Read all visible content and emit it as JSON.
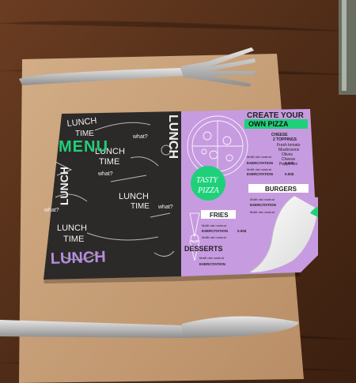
{
  "left_panel": {
    "menu": "MENU",
    "lunch_big": "LUNCH",
    "lunch_time": [
      "LUNCH",
      "TIME"
    ],
    "lunch_time_2": [
      "LUNCH",
      "TIME"
    ],
    "lunch_time_3": [
      "LUNCH",
      "TIME"
    ],
    "lunch_vertical": "LUNCH",
    "whats": [
      "what?",
      "what?",
      "what?",
      "what?"
    ]
  },
  "right_panel": {
    "create_your": "CREATE YOUR",
    "own_pizza": "OWN PIZZA",
    "toppings_title": "CHEESE\n2 TOPPINGS",
    "toppings": [
      "Fresh tomato",
      "Mushrooms",
      "Olives",
      "Cheese",
      "Pepperoni"
    ],
    "tasty": "TASTY",
    "pizza": "PIZZA",
    "burgers": "BURGERS",
    "fries": "FRIES",
    "desserts": "DESSERTS",
    "item_text": "Mollit nisi nostrud",
    "exercitation": "EXERCITATION",
    "price": "0.00$"
  },
  "colors": {
    "green": "#1fd07a",
    "purple_panel": "#c79be0",
    "purple_text": "#b58de0",
    "chalkboard": "#2c2a28",
    "kraft": "#c9a27a"
  }
}
